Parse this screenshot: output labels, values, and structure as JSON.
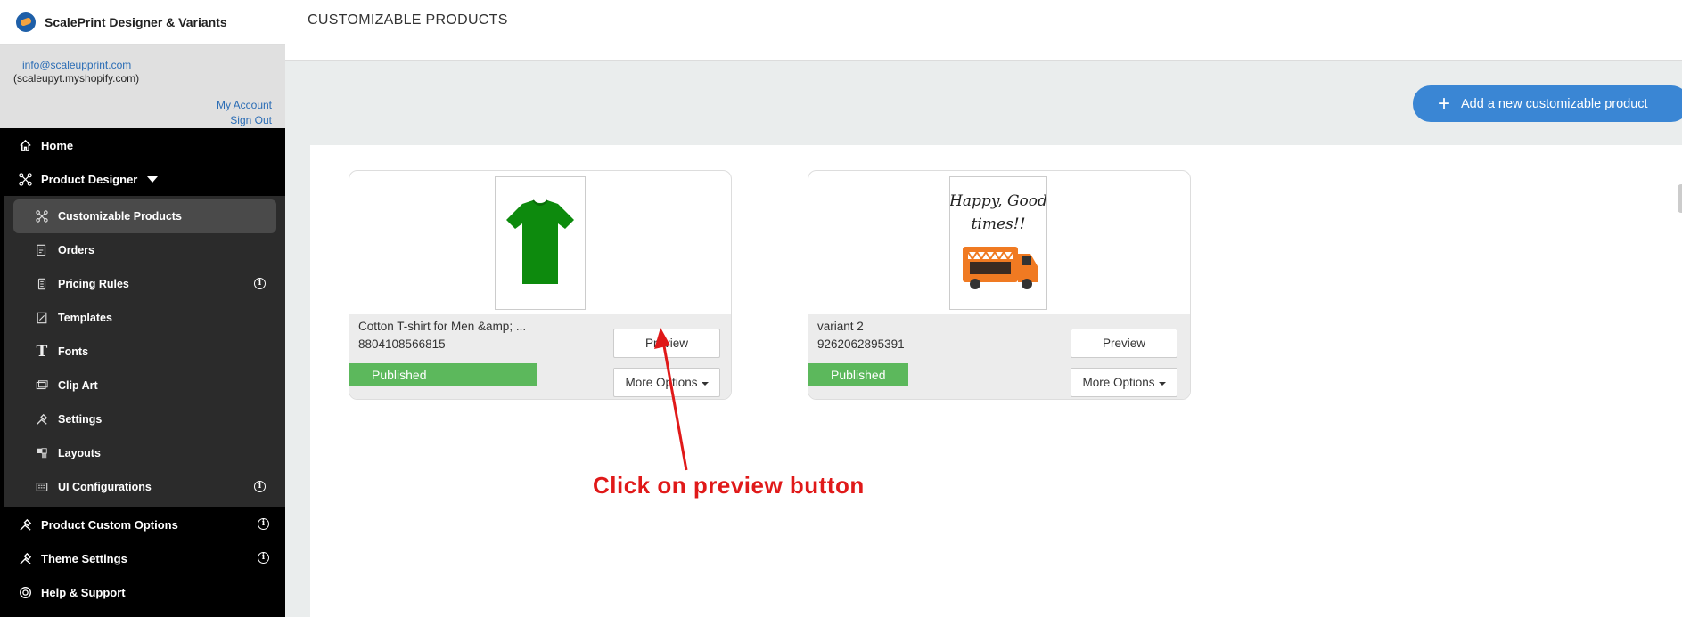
{
  "app": {
    "title": "ScalePrint Designer & Variants"
  },
  "account": {
    "email": "info@scaleupprint.com",
    "shop": "(scaleupyt.myshopify.com)",
    "my_account": "My Account",
    "sign_out": "Sign Out"
  },
  "nav": {
    "home": "Home",
    "product_designer": "Product Designer",
    "sub": {
      "customizable_products": "Customizable Products",
      "orders": "Orders",
      "pricing_rules": "Pricing Rules",
      "templates": "Templates",
      "fonts": "Fonts",
      "clip_art": "Clip Art",
      "settings": "Settings",
      "layouts": "Layouts",
      "ui_configurations": "UI Configurations"
    },
    "product_custom_options": "Product Custom Options",
    "theme_settings": "Theme Settings",
    "help_support": "Help & Support"
  },
  "page": {
    "title": "CUSTOMIZABLE PRODUCTS",
    "add_button": "Add a new customizable product"
  },
  "products": [
    {
      "name": "Cotton T-shirt for Men &amp; ...",
      "sku": "8804108566815",
      "status": "Published",
      "preview": "Preview",
      "more": "More Options"
    },
    {
      "name": "variant 2",
      "sku": "9262062895391",
      "status": "Published",
      "preview": "Preview",
      "more": "More Options",
      "image_text_1": "Happy, Good",
      "image_text_2": "times!!"
    }
  ],
  "annotation": "Click on preview button",
  "colors": {
    "sidebar": "#000000",
    "accent": "#3a86d4",
    "published": "#5cb85c",
    "annotation": "#e01919"
  },
  "icons": {
    "home": "home-icon",
    "designer": "designer-icon",
    "info": "info-icon"
  }
}
